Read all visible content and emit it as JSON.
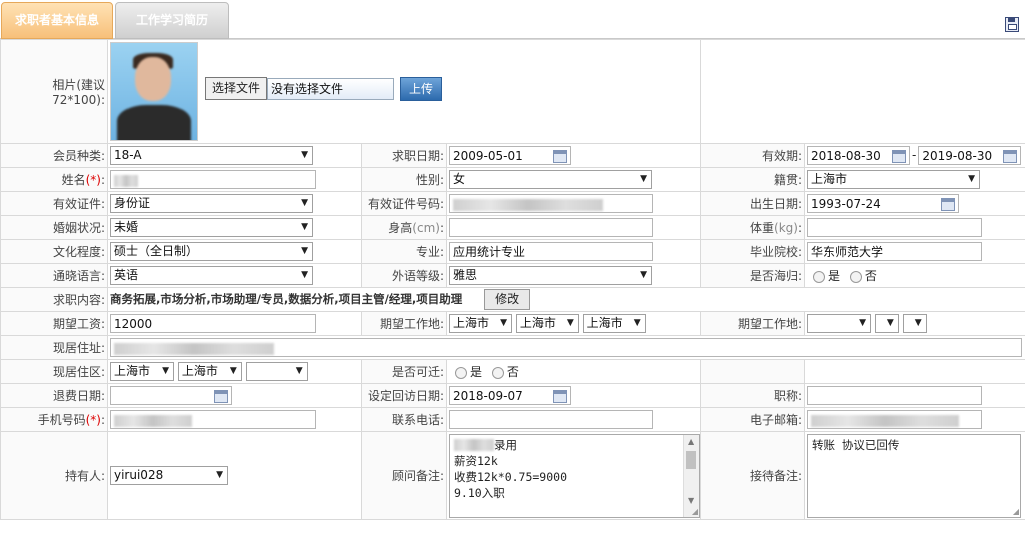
{
  "tabs": [
    {
      "label": "求职者基本信息"
    },
    {
      "label": "工作学习简历"
    }
  ],
  "photo": {
    "label": "相片(建议72*100):",
    "choose_file": "选择文件",
    "no_file": "没有选择文件",
    "upload": "上传"
  },
  "fields": {
    "member_type": {
      "label": "会员种类:",
      "value": "18-A"
    },
    "apply_date": {
      "label": "求职日期:",
      "value": "2009-05-01"
    },
    "valid_period": {
      "label": "有效期:",
      "from": "2018-08-30",
      "sep": "-",
      "to": "2019-08-30"
    },
    "name": {
      "label": "姓名",
      "req": "(*)",
      "colon": ":"
    },
    "gender": {
      "label": "性别:",
      "value": "女"
    },
    "native_place": {
      "label": "籍贯:",
      "value": "上海市"
    },
    "id_type": {
      "label": "有效证件:",
      "value": "身份证"
    },
    "id_number": {
      "label": "有效证件号码:"
    },
    "birth_date": {
      "label": "出生日期:",
      "value": "1993-07-24"
    },
    "marital": {
      "label": "婚姻状况:",
      "value": "未婚"
    },
    "height": {
      "label": "身高",
      "unit": "(cm)",
      "colon": ":"
    },
    "weight": {
      "label": "体重",
      "unit": "(kg)",
      "colon": ":"
    },
    "education": {
      "label": "文化程度:",
      "value": "硕士（全日制）"
    },
    "major": {
      "label": "专业:",
      "value": "应用统计专业"
    },
    "school": {
      "label": "毕业院校:",
      "value": "华东师范大学"
    },
    "language": {
      "label": "通晓语言:",
      "value": "英语"
    },
    "foreign_level": {
      "label": "外语等级:",
      "value": "雅思"
    },
    "returnee": {
      "label": "是否海归:",
      "yes": "是",
      "no": "否"
    },
    "job_content": {
      "label": "求职内容:",
      "value": "商务拓展,市场分析,市场助理/专员,数据分析,项目主管/经理,项目助理",
      "edit": "修改"
    },
    "expected_salary": {
      "label": "期望工资:",
      "value": "12000"
    },
    "expected_place1": {
      "label": "期望工作地:",
      "v1": "上海市",
      "v2": "上海市",
      "v3": "上海市"
    },
    "expected_place2": {
      "label": "期望工作地:"
    },
    "address": {
      "label": "现居住址:"
    },
    "district": {
      "label": "现居住区:",
      "v1": "上海市",
      "v2": "上海市"
    },
    "relocate": {
      "label": "是否可迁:",
      "yes": "是",
      "no": "否"
    },
    "refund_date": {
      "label": "退费日期:"
    },
    "visit_date": {
      "label": "设定回访日期:",
      "value": "2018-09-07"
    },
    "title": {
      "label": "职称:"
    },
    "mobile": {
      "label": "手机号码",
      "req": "(*)",
      "colon": ":"
    },
    "phone": {
      "label": "联系电话:"
    },
    "email": {
      "label": "电子邮箱:"
    },
    "holder": {
      "label": "持有人:",
      "value": "yirui028"
    },
    "consultant_note": {
      "label": "顾问备注:",
      "lines": [
        "录用",
        "薪资12k",
        "收费12k*0.75=9000",
        "9.10入职"
      ]
    },
    "reception_note": {
      "label": "接待备注:",
      "value": "转账 协议已回传"
    }
  }
}
